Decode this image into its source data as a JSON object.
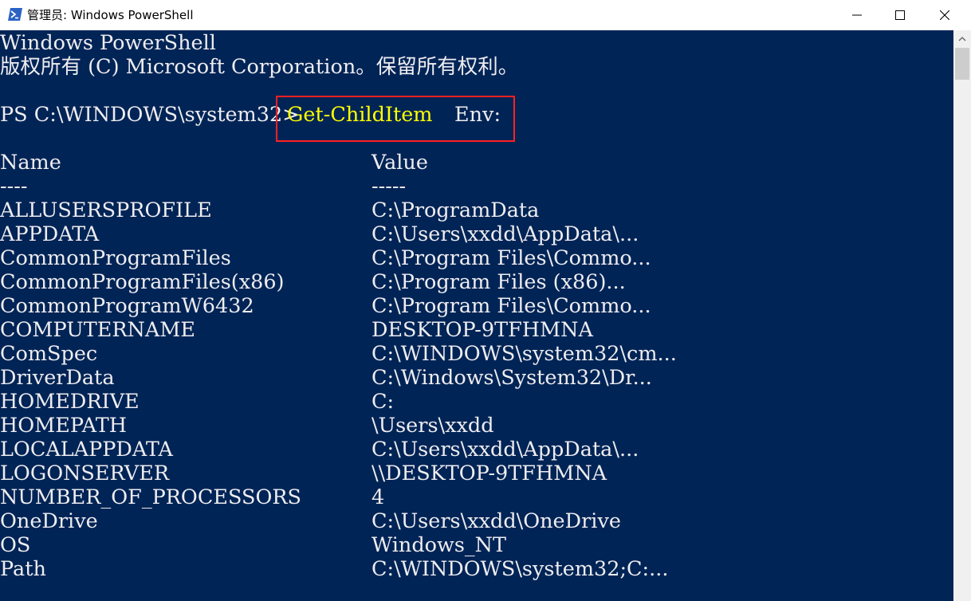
{
  "window": {
    "title": "管理员: Windows PowerShell",
    "minimize": "—",
    "maximize": "☐",
    "close": "✕"
  },
  "console": {
    "banner_line1": "Windows PowerShell",
    "banner_line2": "版权所有 (C) Microsoft Corporation。保留所有权利。",
    "prompt": "PS C:\\WINDOWS\\system32>",
    "command": "Get-ChildItem",
    "argument": "Env:",
    "headers": {
      "name": "Name",
      "value": "Value"
    },
    "separators": {
      "name": "----",
      "value": "-----"
    },
    "rows": [
      {
        "name": "ALLUSERSPROFILE",
        "value": "C:\\ProgramData"
      },
      {
        "name": "APPDATA",
        "value": "C:\\Users\\xxdd\\AppData\\..."
      },
      {
        "name": "CommonProgramFiles",
        "value": "C:\\Program Files\\Commo..."
      },
      {
        "name": "CommonProgramFiles(x86)",
        "value": "C:\\Program Files (x86)..."
      },
      {
        "name": "CommonProgramW6432",
        "value": "C:\\Program Files\\Commo..."
      },
      {
        "name": "COMPUTERNAME",
        "value": "DESKTOP-9TFHMNA"
      },
      {
        "name": "ComSpec",
        "value": "C:\\WINDOWS\\system32\\cm..."
      },
      {
        "name": "DriverData",
        "value": "C:\\Windows\\System32\\Dr..."
      },
      {
        "name": "HOMEDRIVE",
        "value": "C:"
      },
      {
        "name": "HOMEPATH",
        "value": "\\Users\\xxdd"
      },
      {
        "name": "LOCALAPPDATA",
        "value": "C:\\Users\\xxdd\\AppData\\..."
      },
      {
        "name": "LOGONSERVER",
        "value": "\\\\DESKTOP-9TFHMNA"
      },
      {
        "name": "NUMBER_OF_PROCESSORS",
        "value": "4"
      },
      {
        "name": "OneDrive",
        "value": "C:\\Users\\xxdd\\OneDrive"
      },
      {
        "name": "OS",
        "value": "Windows_NT"
      },
      {
        "name": "Path",
        "value": "C:\\WINDOWS\\system32;C:..."
      }
    ]
  },
  "colors": {
    "background": "#012456",
    "text": "#eeedf0",
    "command": "#ffff00",
    "highlight_border": "#ff2020"
  },
  "icons": {
    "app": "powershell-icon",
    "scroll_up": "chevron-up-icon"
  }
}
